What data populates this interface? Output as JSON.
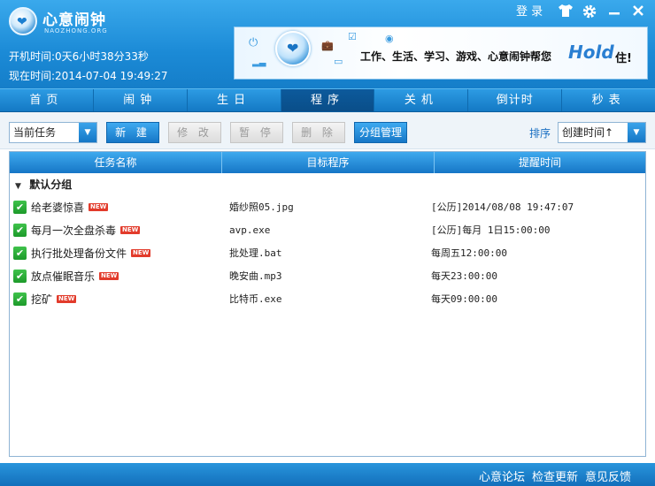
{
  "app": {
    "title": "心意闹钟",
    "subtitle": "NAOZHONG.ORG",
    "uptime_label": "开机时间:",
    "uptime_value": "0天6小时38分33秒",
    "now_label": "现在时间:",
    "now_value": "2014-07-04 19:49:27"
  },
  "titlebar": {
    "login": "登 录",
    "skin_icon": "tshirt-icon",
    "settings_icon": "gear-icon",
    "minimize_icon": "minimize-icon",
    "close_icon": "close-icon"
  },
  "banner": {
    "text": "工作、生活、学习、游戏、心意闹钟帮您",
    "hold": "Hold",
    "tail": "住!"
  },
  "nav": {
    "tabs": [
      {
        "label": "首页"
      },
      {
        "label": "闹钟"
      },
      {
        "label": "生日"
      },
      {
        "label": "程序"
      },
      {
        "label": "关机"
      },
      {
        "label": "倒计时"
      },
      {
        "label": "秒表"
      }
    ],
    "active_index": 3
  },
  "toolbar": {
    "filter_value": "当前任务",
    "new_label": "新 建",
    "edit_label": "修 改",
    "pause_label": "暂 停",
    "delete_label": "删 除",
    "group_label": "分组管理",
    "sort_label": "排序",
    "sort_value": "创建时间↑"
  },
  "table": {
    "headers": [
      "任务名称",
      "目标程序",
      "提醒时间"
    ],
    "group_name": "默认分组",
    "new_badge": "NEW",
    "rows": [
      {
        "name": "给老婆惊喜",
        "target": "婚纱照05.jpg",
        "time": "[公历]2014/08/08 19:47:07"
      },
      {
        "name": "每月一次全盘杀毒",
        "target": "avp.exe",
        "time": "[公历]每月 1日15:00:00"
      },
      {
        "name": "执行批处理备份文件",
        "target": "批处理.bat",
        "time": "每周五12:00:00"
      },
      {
        "name": "放点催眠音乐",
        "target": "晚安曲.mp3",
        "time": "每天23:00:00"
      },
      {
        "name": "挖矿",
        "target": "比特币.exe",
        "time": "每天09:00:00"
      }
    ]
  },
  "footer": {
    "forum": "心意论坛",
    "update": "检查更新",
    "feedback": "意见反馈"
  },
  "colors": {
    "primary": "#1b8ad6",
    "nav_active": "#0c5a9c",
    "check_green": "#1d9a2a",
    "new_red": "#e23b2b"
  }
}
